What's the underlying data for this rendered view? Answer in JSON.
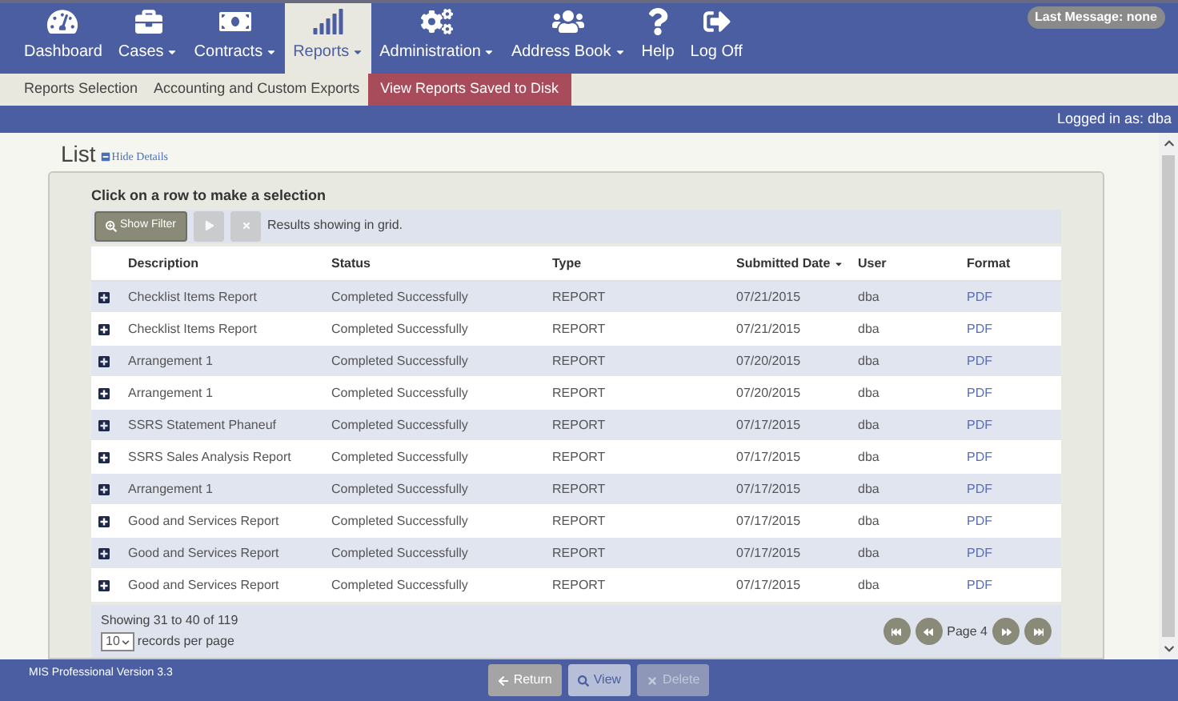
{
  "nav": {
    "items": [
      {
        "label": "Dashboard",
        "dropdown": false,
        "selected": false
      },
      {
        "label": "Cases",
        "dropdown": true,
        "selected": false
      },
      {
        "label": "Contracts",
        "dropdown": true,
        "selected": false
      },
      {
        "label": "Reports",
        "dropdown": true,
        "selected": true
      },
      {
        "label": "Administration",
        "dropdown": true,
        "selected": false
      },
      {
        "label": "Address Book",
        "dropdown": true,
        "selected": false
      },
      {
        "label": "Help",
        "dropdown": false,
        "selected": false
      },
      {
        "label": "Log Off",
        "dropdown": false,
        "selected": false
      }
    ],
    "last_message": "Last Message: none"
  },
  "subnav": [
    {
      "label": "Reports Selection",
      "selected": false
    },
    {
      "label": "Accounting and Custom Exports",
      "selected": false
    },
    {
      "label": "View Reports Saved to Disk",
      "selected": true
    }
  ],
  "logged_in": "Logged in as: dba",
  "list": {
    "title": "List",
    "toggle": "Hide Details",
    "instruction": "Click on a row to make a selection",
    "toolbar": {
      "buttons": [
        {
          "label": "Show Filter",
          "disabled": false
        },
        {
          "kind": "play",
          "disabled": true
        },
        {
          "kind": "clear",
          "disabled": true
        }
      ],
      "status": "Results showing in grid."
    },
    "columns": [
      {
        "label": "Description",
        "sorted": false
      },
      {
        "label": "Status",
        "sorted": false
      },
      {
        "label": "Type",
        "sorted": false
      },
      {
        "label": "Submitted Date",
        "sorted": true
      },
      {
        "label": "User",
        "sorted": false
      },
      {
        "label": "Format",
        "sorted": false
      }
    ],
    "rows": [
      {
        "description": "Checklist Items Report",
        "status": "Completed Successfully",
        "type": "REPORT",
        "submitted_date": "07/21/2015",
        "user": "dba",
        "format": "PDF"
      },
      {
        "description": "Checklist Items Report",
        "status": "Completed Successfully",
        "type": "REPORT",
        "submitted_date": "07/21/2015",
        "user": "dba",
        "format": "PDF"
      },
      {
        "description": "Arrangement 1",
        "status": "Completed Successfully",
        "type": "REPORT",
        "submitted_date": "07/20/2015",
        "user": "dba",
        "format": "PDF"
      },
      {
        "description": "Arrangement 1",
        "status": "Completed Successfully",
        "type": "REPORT",
        "submitted_date": "07/20/2015",
        "user": "dba",
        "format": "PDF"
      },
      {
        "description": "SSRS Statement Phaneuf",
        "status": "Completed Successfully",
        "type": "REPORT",
        "submitted_date": "07/17/2015",
        "user": "dba",
        "format": "PDF"
      },
      {
        "description": "SSRS Sales Analysis Report",
        "status": "Completed Successfully",
        "type": "REPORT",
        "submitted_date": "07/17/2015",
        "user": "dba",
        "format": "PDF"
      },
      {
        "description": "Arrangement 1",
        "status": "Completed Successfully",
        "type": "REPORT",
        "submitted_date": "07/17/2015",
        "user": "dba",
        "format": "PDF"
      },
      {
        "description": "Good and Services Report",
        "status": "Completed Successfully",
        "type": "REPORT",
        "submitted_date": "07/17/2015",
        "user": "dba",
        "format": "PDF"
      },
      {
        "description": "Good and Services Report",
        "status": "Completed Successfully",
        "type": "REPORT",
        "submitted_date": "07/17/2015",
        "user": "dba",
        "format": "PDF"
      },
      {
        "description": "Good and Services Report",
        "status": "Completed Successfully",
        "type": "REPORT",
        "submitted_date": "07/17/2015",
        "user": "dba",
        "format": "PDF"
      }
    ],
    "showing": "Showing 31 to 40 of 119",
    "page_size": "10",
    "page_size_label": "records per page",
    "page": "Page 4"
  },
  "footer": {
    "version": "MIS Professional Version 3.3",
    "buttons": [
      {
        "label": "Return",
        "kind": "return",
        "disabled": false
      },
      {
        "label": "View",
        "kind": "view",
        "disabled": false
      },
      {
        "label": "Delete",
        "kind": "delete",
        "disabled": true
      }
    ]
  }
}
